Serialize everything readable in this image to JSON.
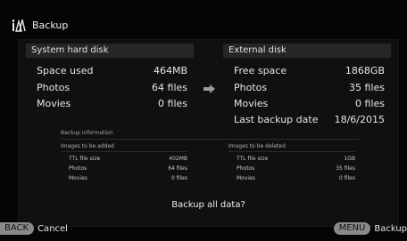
{
  "header": {
    "title": "Backup",
    "icon": "backup-icon"
  },
  "system_disk": {
    "title": "System hard disk",
    "rows": [
      {
        "label": "Space used",
        "value": "464MB"
      },
      {
        "label": "Photos",
        "value": "64 files"
      },
      {
        "label": "Movies",
        "value": "0 files"
      }
    ]
  },
  "external_disk": {
    "title": "External disk",
    "rows": [
      {
        "label": "Free space",
        "value": "1868GB"
      },
      {
        "label": "Photos",
        "value": "35 files"
      },
      {
        "label": "Movies",
        "value": "0 files"
      },
      {
        "label": "Last backup date",
        "value": "18/6/2015"
      }
    ]
  },
  "backup_info": {
    "title": "Backup information",
    "added": {
      "title": "Images to be added",
      "rows": [
        {
          "label": "TTL file size",
          "value": "402MB"
        },
        {
          "label": "Photos",
          "value": "64 files"
        },
        {
          "label": "Movies",
          "value": "0 files"
        }
      ]
    },
    "deleted": {
      "title": "Images to be deleted",
      "rows": [
        {
          "label": "TTL file size",
          "value": "1GB"
        },
        {
          "label": "Photos",
          "value": "35 files"
        },
        {
          "label": "Movies",
          "value": "0 files"
        }
      ]
    }
  },
  "prompt": "Backup all data?",
  "footer": {
    "back_key": "BACK",
    "back_label": "Cancel",
    "menu_key": "MENU",
    "menu_label": "Backup"
  },
  "colors": {
    "background": "#050505",
    "panel": "#101010",
    "key": "#8a8a8a"
  }
}
